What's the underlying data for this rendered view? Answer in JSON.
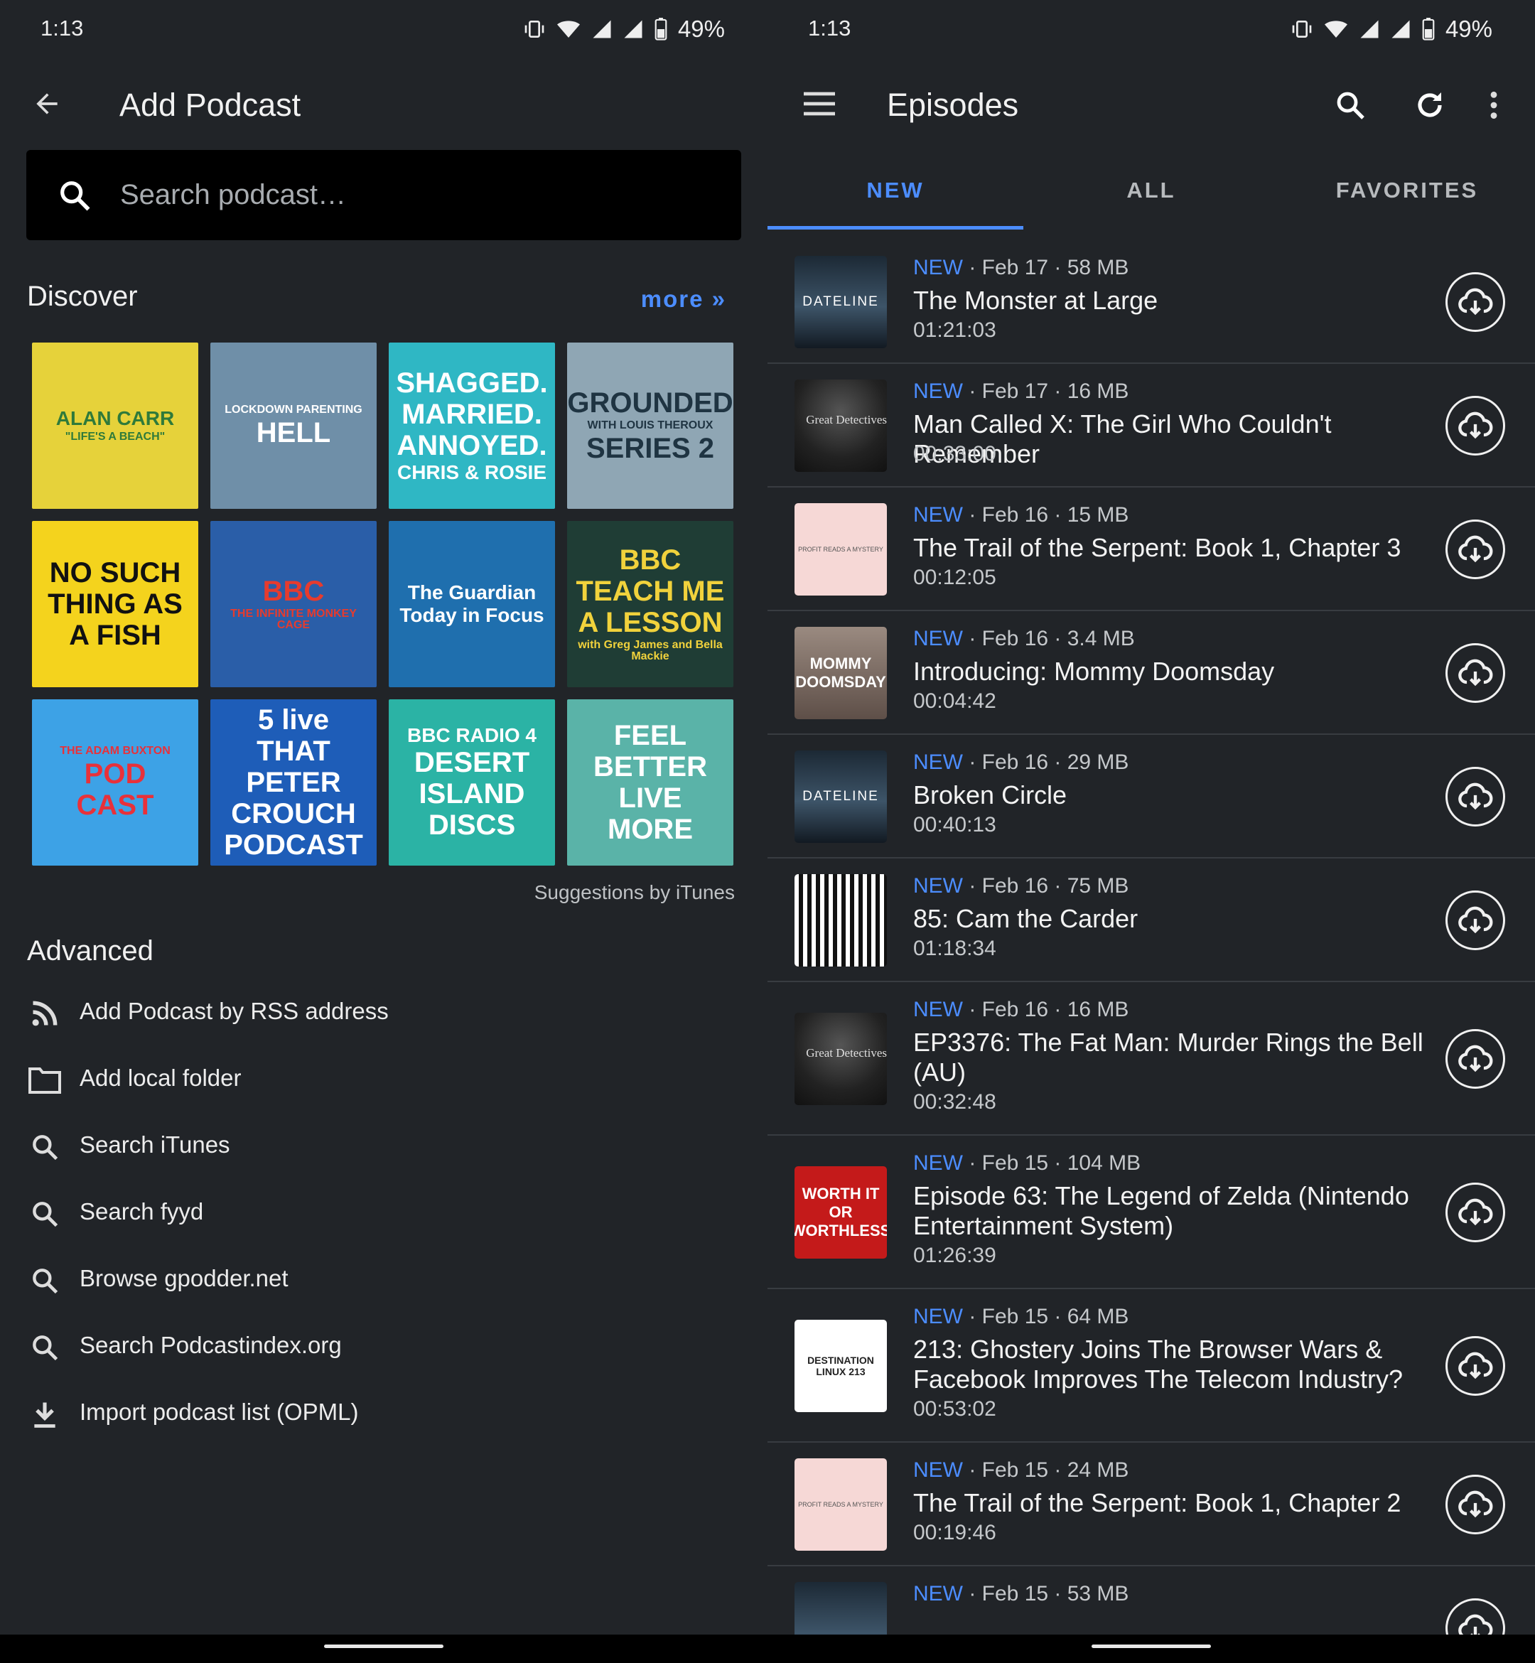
{
  "left": {
    "status": {
      "time": "1:13",
      "battery": "49%"
    },
    "appbar": {
      "title": "Add Podcast",
      "back_icon": "arrow-back-icon"
    },
    "search": {
      "placeholder": "Search podcast…"
    },
    "discover": {
      "title": "Discover",
      "more_label": "more »",
      "tiles": [
        {
          "lines": [
            "ALAN CARR",
            "\"LIFE'S A BEACH\""
          ],
          "bg": "#e6d23a",
          "fg": "#2f7a3a"
        },
        {
          "lines": [
            "LOCKDOWN PARENTING",
            "HELL"
          ],
          "bg": "#6f8fa8",
          "fg": "#ffffff"
        },
        {
          "lines": [
            "SHAGGED.",
            "MARRIED.",
            "ANNOYED.",
            "CHRIS & ROSIE"
          ],
          "bg": "#2fb7c4",
          "fg": "#ffffff"
        },
        {
          "lines": [
            "GROUNDED",
            "WITH LOUIS THEROUX",
            "SERIES 2"
          ],
          "bg": "#8fa6b4",
          "fg": "#1f3442"
        },
        {
          "lines": [
            "NO SUCH",
            "THING AS",
            "A FISH"
          ],
          "bg": "#f4d31d",
          "fg": "#111111"
        },
        {
          "lines": [
            "BBC",
            "THE INFINITE MONKEY CAGE"
          ],
          "bg": "#2a5ea8",
          "fg": "#e63b2e"
        },
        {
          "lines": [
            "The Guardian",
            "Today in Focus"
          ],
          "bg": "#1f6fae",
          "fg": "#ffffff"
        },
        {
          "lines": [
            "BBC",
            "TEACH ME",
            "A LESSON",
            "with Greg James and Bella Mackie"
          ],
          "bg": "#1f3d35",
          "fg": "#f1d23c"
        },
        {
          "lines": [
            "THE ADAM BUXTON",
            "POD",
            "CAST"
          ],
          "bg": "#3da2e6",
          "fg": "#e8313a"
        },
        {
          "lines": [
            "5 live",
            "THAT",
            "PETER",
            "CROUCH",
            "PODCAST"
          ],
          "bg": "#1e5db8",
          "fg": "#ffffff"
        },
        {
          "lines": [
            "BBC RADIO 4",
            "DESERT",
            "ISLAND",
            "DISCS"
          ],
          "bg": "#2bb3a5",
          "fg": "#ffffff"
        },
        {
          "lines": [
            "FEEL",
            "BETTER",
            "LIVE",
            "MORE"
          ],
          "bg": "#5ab3a8",
          "fg": "#ffffff"
        }
      ],
      "suggestions": "Suggestions by iTunes"
    },
    "advanced": {
      "title": "Advanced",
      "items": [
        {
          "label": "Add Podcast by RSS address",
          "icon": "rss-icon"
        },
        {
          "label": "Add local folder",
          "icon": "folder-icon"
        },
        {
          "label": "Search iTunes",
          "icon": "search-icon"
        },
        {
          "label": "Search fyyd",
          "icon": "search-icon"
        },
        {
          "label": "Browse gpodder.net",
          "icon": "search-icon"
        },
        {
          "label": "Search Podcastindex.org",
          "icon": "search-icon"
        },
        {
          "label": "Import podcast list (OPML)",
          "icon": "download-icon"
        }
      ]
    }
  },
  "right": {
    "status": {
      "time": "1:13",
      "battery": "49%"
    },
    "appbar": {
      "title": "Episodes",
      "menu_icon": "hamburger-menu-icon",
      "search_icon": "search-icon",
      "refresh_icon": "refresh-icon",
      "overflow_icon": "more-vert-icon"
    },
    "tabs": [
      {
        "label": "NEW",
        "active": true
      },
      {
        "label": "ALL",
        "active": false
      },
      {
        "label": "FAVORITES",
        "active": false
      }
    ],
    "episodes": [
      {
        "badge": "NEW",
        "info": " · Feb 17 · 58 MB",
        "title": "The Monster at Large",
        "duration": "01:21:03",
        "art": "dateline",
        "art_text": "DATELINE"
      },
      {
        "badge": "NEW",
        "info": " · Feb 17 · 16 MB",
        "title": "Man Called X: The Girl Who Couldn't Remember",
        "duration": "00:33:00",
        "art": "detect",
        "art_text": "Great Detectives"
      },
      {
        "badge": "NEW",
        "info": " · Feb 16 · 15 MB",
        "title": "The Trail of the Serpent: Book 1, Chapter 3",
        "duration": "00:12:05",
        "art": "serpent",
        "art_text": "PROFIT READS A MYSTERY"
      },
      {
        "badge": "NEW",
        "info": " · Feb 16 · 3.4 MB",
        "title": "Introducing: Mommy Doomsday",
        "duration": "00:04:42",
        "art": "mommy",
        "art_text": "MOMMY DOOMSDAY"
      },
      {
        "badge": "NEW",
        "info": " · Feb 16 · 29 MB",
        "title": "Broken Circle",
        "duration": "00:40:13",
        "art": "dateline",
        "art_text": "DATELINE"
      },
      {
        "badge": "NEW",
        "info": " · Feb 16 · 75 MB",
        "title": "85: Cam the Carder",
        "duration": "01:18:34",
        "art": "cam",
        "art_text": ""
      },
      {
        "badge": "NEW",
        "info": " · Feb 16 · 16 MB",
        "title": "EP3376: The Fat Man: Murder Rings the Bell (AU)",
        "duration": "00:32:48",
        "art": "detect",
        "art_text": "Great Detectives"
      },
      {
        "badge": "NEW",
        "info": " · Feb 15 · 104 MB",
        "title": "Episode 63: The Legend of Zelda (Nintendo Entertainment System)",
        "duration": "01:26:39",
        "art": "worth",
        "art_text": "WORTH IT OR WORTHLESS"
      },
      {
        "badge": "NEW",
        "info": " · Feb 15 · 64 MB",
        "title": "213: Ghostery Joins The Browser Wars & Facebook Improves The Telecom Industry?",
        "duration": "00:53:02",
        "art": "destlinux",
        "art_text": "DESTINATION LINUX 213"
      },
      {
        "badge": "NEW",
        "info": " · Feb 15 · 24 MB",
        "title": "The Trail of the Serpent: Book 1, Chapter 2",
        "duration": "00:19:46",
        "art": "serpent",
        "art_text": "PROFIT READS A MYSTERY"
      },
      {
        "badge": "NEW",
        "info": " · Feb 15 · 53 MB",
        "title": "",
        "duration": "",
        "art": "dateline",
        "art_text": ""
      }
    ]
  },
  "colors": {
    "background": "#212428",
    "accent": "#4c8dff",
    "search_bg": "#000000",
    "divider": "#383c41"
  }
}
